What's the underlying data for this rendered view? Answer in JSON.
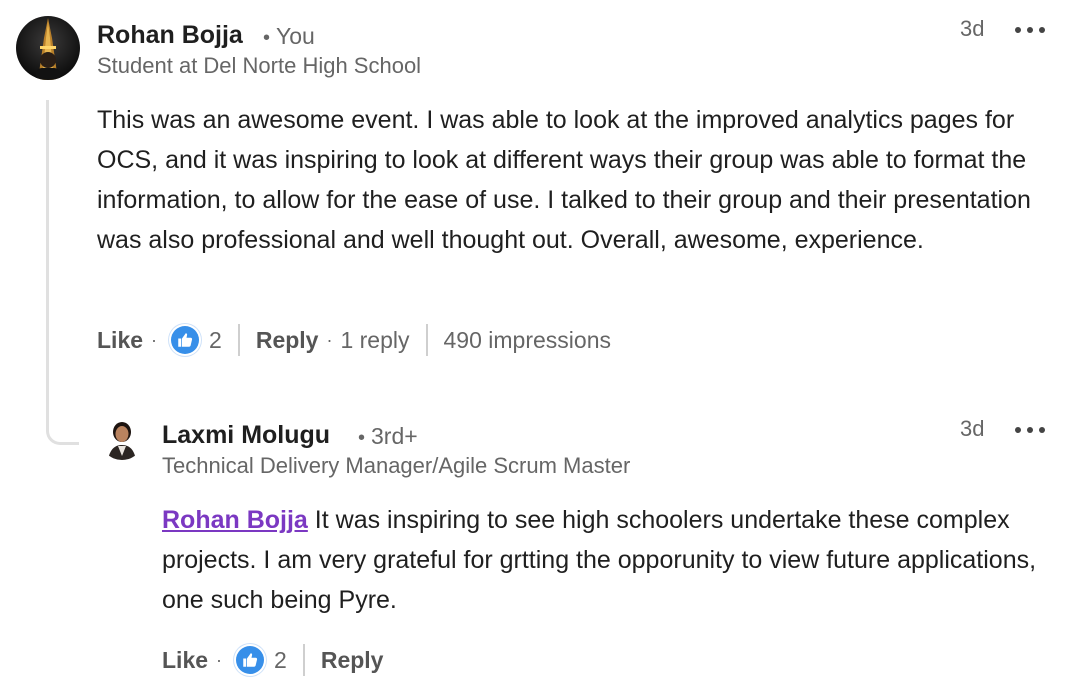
{
  "comment": {
    "author": "Rohan Bojja",
    "degree": "You",
    "headline": "Student at Del Norte High School",
    "time": "3d",
    "body": "This was an awesome event. I was able to look at the improved analytics pages for OCS, and it was inspiring to look at different ways their group was able to format the information, to allow for the ease of use. I talked to their group and their presentation was also professional and well thought out. Overall, awesome, experience.",
    "like_label": "Like",
    "reaction_count": "2",
    "reply_label": "Reply",
    "reply_count": "1 reply",
    "impressions": "490 impressions"
  },
  "reply": {
    "author": "Laxmi Molugu",
    "degree": "3rd+",
    "headline": "Technical Delivery Manager/Agile Scrum Master",
    "time": "3d",
    "mention": "Rohan Bojja",
    "body": "It was inspiring to see high schoolers undertake these complex projects. I am very grateful for grtting the opporunity to view future applications, one such being Pyre.",
    "like_label": "Like",
    "reaction_count": "2",
    "reply_label": "Reply"
  },
  "icons": {
    "more": "more-horizontal-icon",
    "reaction": "thumbs-up-like-icon"
  },
  "colors": {
    "mention": "#7b38c2",
    "like_badge": "#378fe9",
    "secondary_text": "#666666"
  }
}
